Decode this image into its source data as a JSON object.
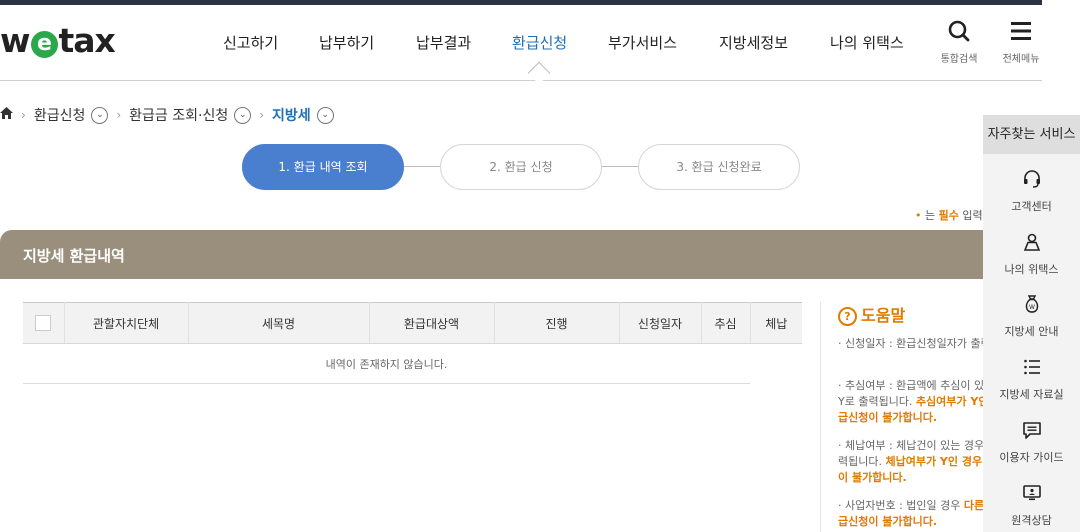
{
  "header": {
    "logo_pre": "w",
    "logo_e": "e",
    "logo_post": "tax",
    "nav": [
      "신고하기",
      "납부하기",
      "납부결과",
      "환급신청",
      "부가서비스",
      "지방세정보",
      "나의 위택스"
    ],
    "active_nav": "환급신청",
    "search_label": "통합검색",
    "menu_label": "전체메뉴"
  },
  "breadcrumb": [
    "환급신청",
    "환급금 조회·신청",
    "지방세"
  ],
  "steps": [
    "1. 환급 내역 조회",
    "2. 환급 신청",
    "3. 환급 신청완료"
  ],
  "required_note": {
    "prefix": "는 ",
    "required": "필수",
    "suffix": " 입력항"
  },
  "panel": {
    "title": "지방세 환급내역",
    "columns": [
      "관할자치단체",
      "세목명",
      "환급대상액",
      "진행",
      "신청일자",
      "추심",
      "체납"
    ],
    "empty_message": "내역이 존재하지 않습니다."
  },
  "help": {
    "title": "도움말",
    "items": [
      {
        "text": "신청일자 : 환급신청일자가 출력됩니다.",
        "bold": ""
      },
      {
        "text": "추심여부 : 환급액에 추심이 있는 경우 Y로 출력됩니다. ",
        "bold": "추심여부가 Y인 경우 환급신청이 불가합니다."
      },
      {
        "text": "체납여부 : 체납건이 있는 경우 Y로 출력됩니다. ",
        "bold": "체납여부가 Y인 경우 환급신청이 불가합니다."
      },
      {
        "text": "사업자번호 : 법인일 경우 ",
        "bold": "다른 경우 환급신청이 불가합니다."
      }
    ]
  },
  "quick": {
    "title": "자주찾는 서비스",
    "items": [
      "고객센터",
      "나의 위택스",
      "지방세 안내",
      "지방세 자료실",
      "이용자 가이드",
      "원격상담"
    ]
  }
}
